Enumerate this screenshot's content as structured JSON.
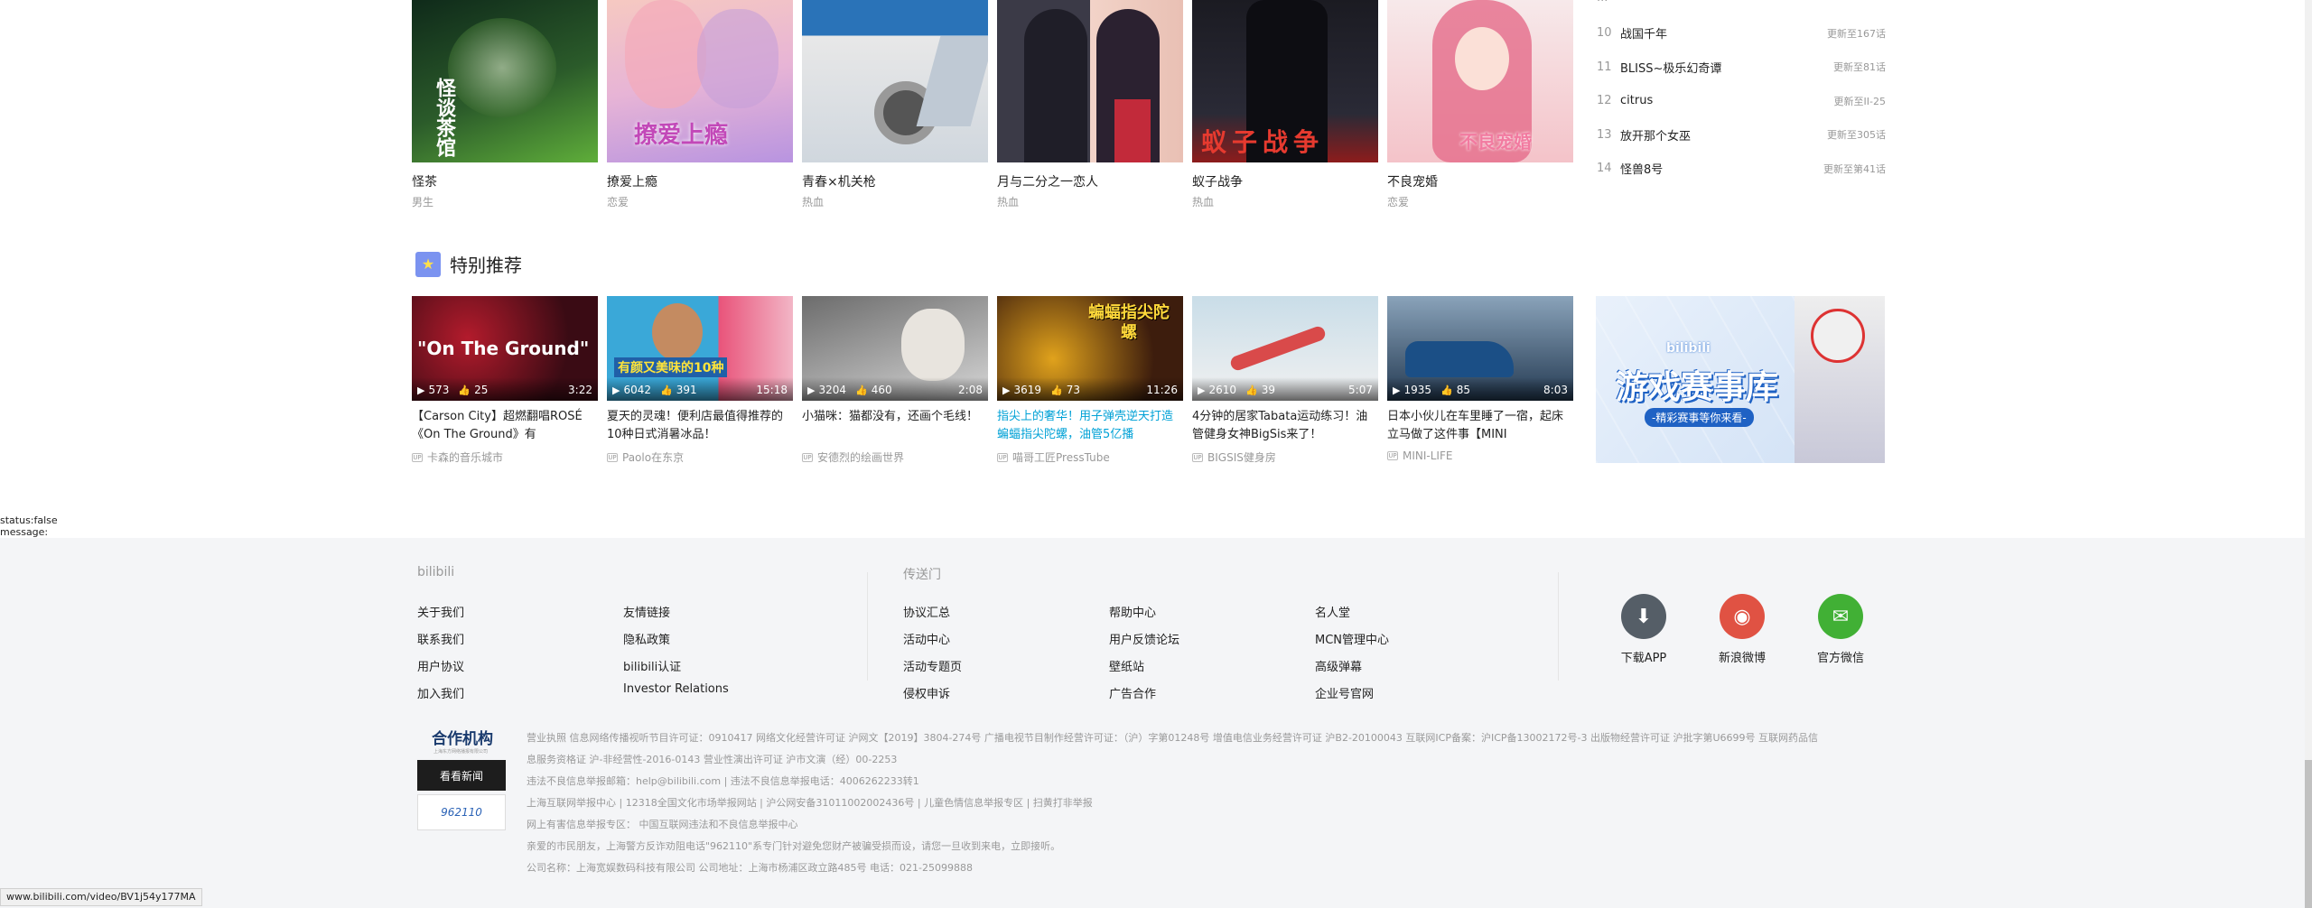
{
  "manga": [
    {
      "title": "怪茶",
      "tag": "男生",
      "cover_text": "怪谈茶馆",
      "c1": "#0f2a1a",
      "c2": "#5fae3a"
    },
    {
      "title": "撩爱上瘾",
      "tag": "恋爱",
      "cover_text": "撩爱上瘾",
      "c1": "#f6c9c1",
      "c2": "#b894e0"
    },
    {
      "title": "青春×机关枪",
      "tag": "热血",
      "cover_text": "",
      "c1": "#2a73b8",
      "c2": "#e8e8e8"
    },
    {
      "title": "月与二分之一恋人",
      "tag": "热血",
      "cover_text": "",
      "c1": "#3b3a47",
      "c2": "#f2d3c8"
    },
    {
      "title": "蚁子战争",
      "tag": "热血",
      "cover_text": "蚁子战争",
      "c1": "#1b1b22",
      "c2": "#8d1c1c"
    },
    {
      "title": "不良宠婚",
      "tag": "恋爱",
      "cover_text": "不良宠婚",
      "c1": "#f4c3c9",
      "c2": "#f7e9ea"
    }
  ],
  "ranking": {
    "cut_item": "...",
    "items": [
      {
        "num": "10",
        "title": "战国千年",
        "update": "更新至167话"
      },
      {
        "num": "11",
        "title": "BLISS~极乐幻奇谭",
        "update": "更新至81话"
      },
      {
        "num": "12",
        "title": "citrus",
        "update": "更新至II-25"
      },
      {
        "num": "13",
        "title": "放开那个女巫",
        "update": "更新至305话"
      },
      {
        "num": "14",
        "title": "怪兽8号",
        "update": "更新至第41话"
      }
    ]
  },
  "special": {
    "title": "特别推荐",
    "videos": [
      {
        "title": "【Carson City】超燃翻唱ROSÉ《On The Ground》有",
        "up": "卡森的音乐城市",
        "plays": "573",
        "likes": "25",
        "duration": "3:22",
        "thumb_text": "\"On The Ground\"",
        "c1": "#3a0b14",
        "c2": "#b31b2c",
        "hl": false
      },
      {
        "title": "夏天的灵魂！便利店最值得推荐的10种日式消暑冰品！",
        "up": "Paolo在东京",
        "plays": "6042",
        "likes": "391",
        "duration": "15:18",
        "thumb_text": "有颜又美味的10种",
        "c1": "#3aa8d8",
        "c2": "#e9537a",
        "hl": false
      },
      {
        "title": "小猫咪：猫都没有，还画个毛线！",
        "up": "安德烈的绘画世界",
        "plays": "3204",
        "likes": "460",
        "duration": "2:08",
        "thumb_text": "",
        "c1": "#6c6c6c",
        "c2": "#d6d6d6",
        "hl": false
      },
      {
        "title": "指尖上的奢华！用子弹壳逆天打造蝙蝠指尖陀螺，油管5亿播",
        "up": "喵哥工匠PressTube",
        "plays": "3619",
        "likes": "73",
        "duration": "11:26",
        "thumb_text": "蝙蝠指尖陀螺",
        "c1": "#3d1d0d",
        "c2": "#e0a21c",
        "hl": true
      },
      {
        "title": "4分钟的居家Tabata运动练习！油管健身女神BigSis来了！",
        "up": "BIGSIS健身房",
        "plays": "2610",
        "likes": "39",
        "duration": "5:07",
        "thumb_text": "",
        "c1": "#c9dde8",
        "c2": "#f1f1f1",
        "hl": false
      },
      {
        "title": "日本小伙儿在车里睡了一宿，起床立马做了这件事【MINI",
        "up": "MINI-LIFE",
        "plays": "1935",
        "likes": "85",
        "duration": "8:03",
        "thumb_text": "",
        "c1": "#243a52",
        "c2": "#8aa3ba",
        "hl": false
      }
    ],
    "ad": {
      "brand": "bilibili",
      "title": "游戏赛事库",
      "subtitle": "-精彩赛事等你来看-"
    }
  },
  "debug": {
    "status": "status:false",
    "message": "message:"
  },
  "footer": {
    "col1_title": "bilibili",
    "col1_a": [
      "关于我们",
      "联系我们",
      "用户协议",
      "加入我们"
    ],
    "col1_b": [
      "友情链接",
      "隐私政策",
      "bilibili认证",
      "Investor Relations"
    ],
    "col2_title": "传送门",
    "col2_a": [
      "协议汇总",
      "活动中心",
      "活动专题页",
      "侵权申诉"
    ],
    "col2_b": [
      "帮助中心",
      "用户反馈论坛",
      "壁纸站",
      "广告合作"
    ],
    "col2_c": [
      "名人堂",
      "MCN管理中心",
      "高级弹幕",
      "企业号官网"
    ],
    "social": [
      {
        "label": "下载APP",
        "icon": "download-icon",
        "glyph": "⬇",
        "color": "#555e67"
      },
      {
        "label": "新浪微博",
        "icon": "weibo-icon",
        "glyph": "◉",
        "color": "#e05243"
      },
      {
        "label": "官方微信",
        "icon": "wechat-icon",
        "glyph": "✉",
        "color": "#41b035"
      }
    ],
    "partner": {
      "title": "合作机构",
      "sub": "上海东方网络播报有限公司",
      "logo1": "看看新闻",
      "logo2": "962110"
    },
    "legal": [
      "营业执照 信息网络传播视听节目许可证：0910417 网络文化经营许可证 沪网文【2019】3804-274号 广播电视节目制作经营许可证：（沪）字第01248号 增值电信业务经营许可证 沪B2-20100043 互联网ICP备案：沪ICP备13002172号-3 出版物经营许可证 沪批字第U6699号 互联网药品信",
      "息服务资格证 沪-非经营性-2016-0143 营业性演出许可证 沪市文演（经）00-2253",
      "违法不良信息举报邮箱：help@bilibili.com | 违法不良信息举报电话：4006262233转1",
      "上海互联网举报中心 | 12318全国文化市场举报网站 | 沪公网安备31011002002436号 | 儿童色情信息举报专区 | 扫黄打非举报",
      "网上有害信息举报专区： 中国互联网违法和不良信息举报中心",
      "亲爱的市民朋友，上海警方反诈劝阻电话\"962110\"系专门针对避免您财产被骗受损而设，请您一旦收到来电，立即接听。",
      "公司名称：上海宽娱数码科技有限公司 公司地址：上海市杨浦区政立路485号 电话：021-25099888"
    ]
  },
  "status_url": "www.bilibili.com/video/BV1j54y177MA"
}
